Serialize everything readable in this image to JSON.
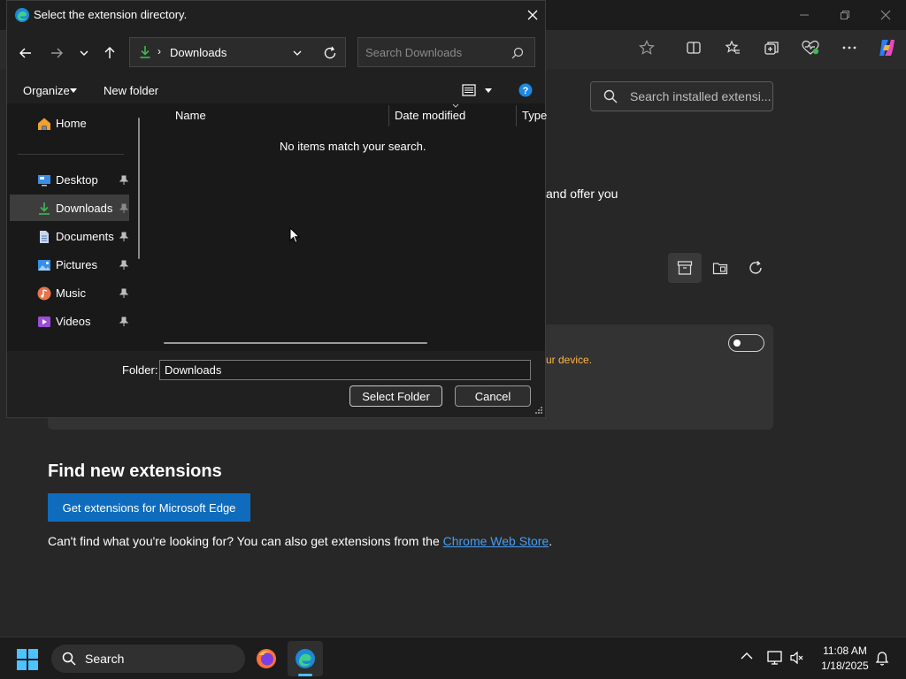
{
  "dialog": {
    "title": "Select the extension directory.",
    "path_crumb": "Downloads",
    "search_placeholder": "Search Downloads",
    "organize_label": "Organize",
    "new_folder_label": "New folder",
    "nav_items": [
      {
        "label": "Home",
        "icon": "home-icon"
      },
      {
        "label": "Desktop",
        "icon": "desktop-icon",
        "pinned": true
      },
      {
        "label": "Downloads",
        "icon": "downloads-icon",
        "pinned": true,
        "selected": true
      },
      {
        "label": "Documents",
        "icon": "documents-icon",
        "pinned": true
      },
      {
        "label": "Pictures",
        "icon": "pictures-icon",
        "pinned": true
      },
      {
        "label": "Music",
        "icon": "music-icon",
        "pinned": true
      },
      {
        "label": "Videos",
        "icon": "videos-icon",
        "pinned": true
      }
    ],
    "columns": [
      "Name",
      "Date modified",
      "Type"
    ],
    "empty_message": "No items match your search.",
    "folder_label": "Folder:",
    "folder_value": "Downloads",
    "select_button": "Select Folder",
    "cancel_button": "Cancel"
  },
  "edge": {
    "search_placeholder": "Search installed extensi...",
    "offer_text": "and offer you",
    "device_text": "ur device.",
    "dev_mode_toggle": "off",
    "find_title": "Find new extensions",
    "get_extensions_button": "Get extensions for Microsoft Edge",
    "cant_find_text": "Can't find what you're looking for? You can also get extensions from the ",
    "store_link": "Chrome Web Store",
    "period": "."
  },
  "taskbar": {
    "search_label": "Search",
    "time": "11:08 AM",
    "date": "1/18/2025",
    "apps": [
      "firefox-icon",
      "edge-icon"
    ]
  },
  "colors": {
    "accent": "#0f6cbd",
    "link": "#479ef5",
    "warning": "#ffb349",
    "download_green": "#3fb950"
  }
}
